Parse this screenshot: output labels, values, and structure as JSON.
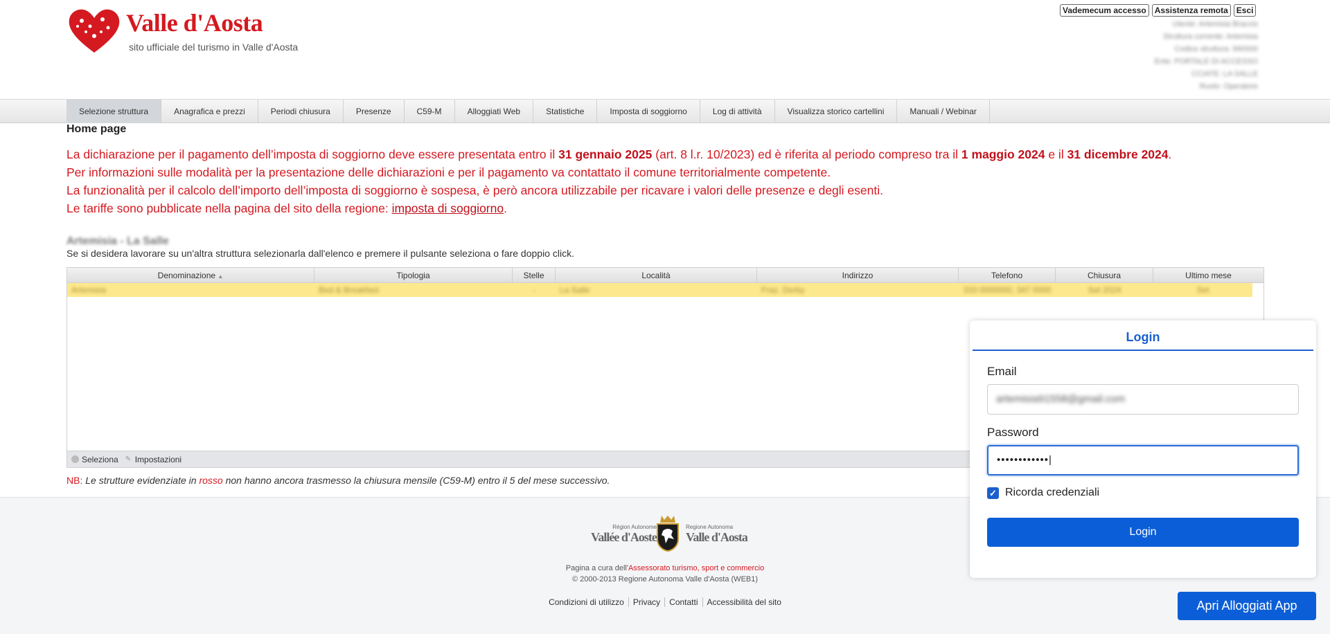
{
  "header": {
    "brand": "Valle d'Aosta",
    "tagline": "sito ufficiale del turismo in Valle d'Aosta",
    "top_links": [
      "Vademecum accesso",
      "Assistenza remota",
      "Esci"
    ],
    "user_info": [
      "Utente: Artemisia Braccio",
      "Struttura corrente: Artemisia",
      "Codice struttura: 990000",
      "Ente: PORTALE DI ACCESSO",
      "CCIATE: LA SALLE",
      "Ruolo: Operatore"
    ]
  },
  "nav": {
    "tabs": [
      "Selezione struttura",
      "Anagrafica e prezzi",
      "Periodi chiusura",
      "Presenze",
      "C59-M",
      "Alloggiati Web",
      "Statistiche",
      "Imposta di soggiorno",
      "Log di attività",
      "Visualizza storico cartellini",
      "Manuali / Webinar"
    ],
    "active": "Selezione struttura"
  },
  "main": {
    "title": "Home page",
    "notice": {
      "l1_a": "La dichiarazione per il pagamento dell’imposta di soggiorno deve essere presentata entro il ",
      "l1_b": "31 gennaio 2025",
      "l1_c": " (art. 8 l.r. 10/2023) ed è riferita al periodo compreso tra il ",
      "l1_d": "1 maggio 2024",
      "l1_e": " e il ",
      "l1_f": "31 dicembre 2024",
      "l1_g": ".",
      "l2": "Per informazioni sulle modalità per la presentazione delle dichiarazioni e per il pagamento va contattato il comune territorialmente competente.",
      "l3": "La funzionalità per il calcolo dell’importo dell’imposta di soggiorno è sospesa, è però ancora utilizzabile per ricavare i valori delle presenze e degli esenti.",
      "l4_a": "Le tariffe sono pubblicate nella pagina del sito della regione: ",
      "l4_link": "imposta di soggiorno",
      "l4_b": "."
    },
    "struct_name": "Artemisia - La Salle",
    "struct_help": "Se si desidera lavorare su un'altra struttura selezionarla dall'elenco e premere il pulsante seleziona o fare doppio click."
  },
  "grid": {
    "columns": [
      "Denominazione",
      "Tipologia",
      "Stelle",
      "Località",
      "Indirizzo",
      "Telefono",
      "Chiusura",
      "Ultimo mese"
    ],
    "sort_indicator": "▲",
    "rows": [
      [
        "Artemisia",
        "Bed & Breakfast",
        "-",
        "La Salle",
        "Fraz. Derby",
        "333 0000000, 347 0000",
        "Set 2024",
        "Set"
      ]
    ],
    "footer": {
      "select": "Seleziona",
      "settings": "Impostazioni"
    }
  },
  "nb": {
    "label": "NB:",
    "text_a": " Le strutture evidenziate in ",
    "red_word": "rosso",
    "text_b": " non hanno ancora trasmesso la chiusura mensile (C59-M) entro il 5 del mese successivo."
  },
  "footer": {
    "ra_left_small": "Région Autonome",
    "ra_left_big": "Vallée d'Aoste",
    "ra_right_small": "Regione Autonoma",
    "ra_right_big": "Valle d'Aosta",
    "credit_a": "Pagina a cura dell'",
    "credit_link": "Assessorato turismo, sport e commercio",
    "copyright": "© 2000-2013 Regione Autonoma Valle d'Aosta (WEB1)",
    "links": [
      "Condizioni di utilizzo",
      "Privacy",
      "Contatti",
      "Accessibilità del sito"
    ]
  },
  "login": {
    "title": "Login",
    "email_label": "Email",
    "email_value": "artemisia91558@gmail.com",
    "password_label": "Password",
    "password_value": "••••••••••••",
    "remember_label": "Ricorda credenziali",
    "remember_checked": true,
    "submit": "Login"
  },
  "app_button": "Apri Alloggiati App",
  "colors": {
    "brand_red": "#d41920",
    "primary_blue": "#0b5ed7",
    "row_highlight": "#fde98d"
  }
}
